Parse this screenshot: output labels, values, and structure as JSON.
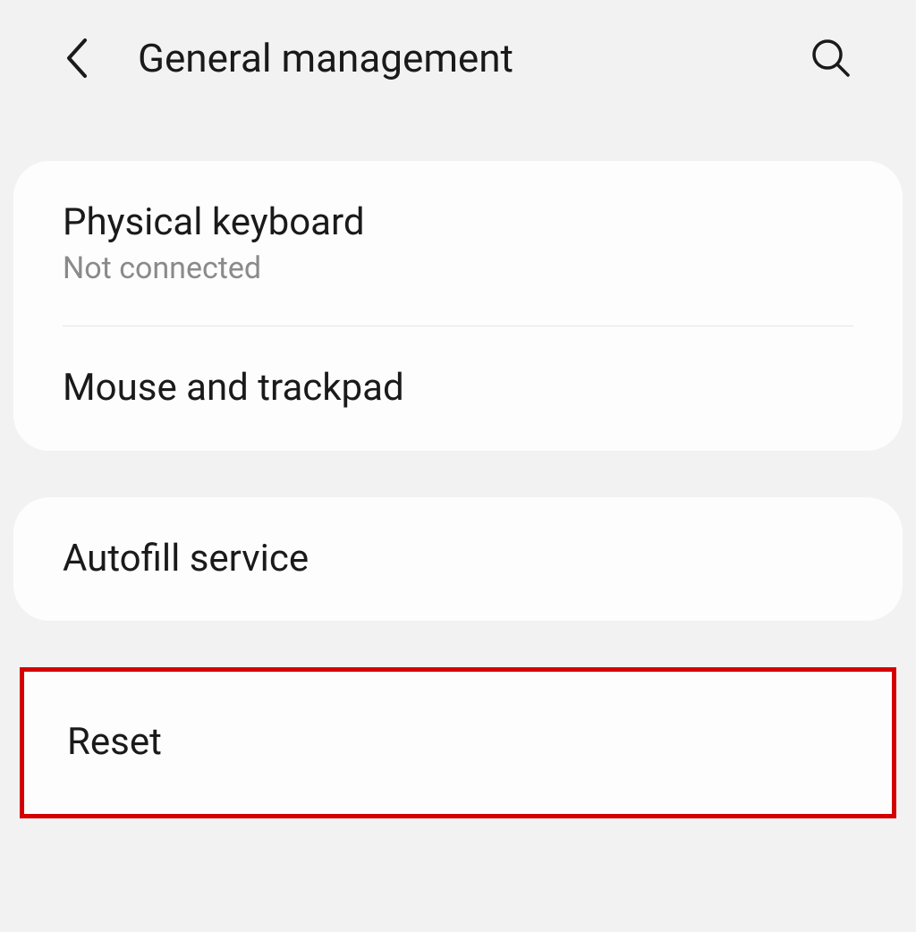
{
  "header": {
    "title": "General management"
  },
  "sections": [
    {
      "items": [
        {
          "title": "Physical keyboard",
          "subtitle": "Not connected"
        },
        {
          "title": "Mouse and trackpad"
        }
      ]
    },
    {
      "items": [
        {
          "title": "Autofill service"
        }
      ]
    },
    {
      "highlighted": true,
      "items": [
        {
          "title": "Reset"
        }
      ]
    }
  ]
}
